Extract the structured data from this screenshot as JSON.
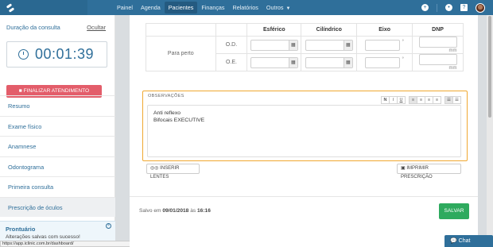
{
  "nav": {
    "items": [
      "Painel",
      "Agenda",
      "Pacientes",
      "Finanças",
      "Relatórios",
      "Outros"
    ],
    "active": "Pacientes"
  },
  "sidebar": {
    "timer_title": "Duração da consulta",
    "hide_label": "Ocultar",
    "timer_value": "00:01:39",
    "finish_button": "FINALIZAR ATENDIMENTO",
    "menu": [
      "Resumo",
      "Exame físico",
      "Anamnese",
      "Odontograma",
      "Primeira consulta",
      "Prescrição de óculos"
    ],
    "active_menu": "Prescrição de óculos",
    "prontuario_title": "Prontuário",
    "prontuario_msg": "Alterações salvas com sucesso!",
    "status_url": "https://app.iclinic.com.br/dashboard/"
  },
  "prescription": {
    "headers": [
      "Esférico",
      "Cilíndrico",
      "Eixo",
      "DNP"
    ],
    "row_group": "Para perto",
    "rows": [
      "O.D.",
      "O.E."
    ],
    "degree": "°",
    "unit": "mm"
  },
  "observations": {
    "label": "OBSERVAÇÕES",
    "toolbar": [
      "N",
      "I",
      "U"
    ],
    "line1": "Anti reflexo",
    "line2": "Bifocais EXECUTIVE"
  },
  "actions": {
    "insert_lenses": "INSERIR LENTES",
    "print": "IMPRIMIR PRESCRIÇÃO",
    "saved_prefix": "Salvo em",
    "saved_date": "09/01/2018",
    "saved_mid": "às",
    "saved_time": "16:16",
    "save": "SALVAR"
  },
  "chat_label": "Chat"
}
